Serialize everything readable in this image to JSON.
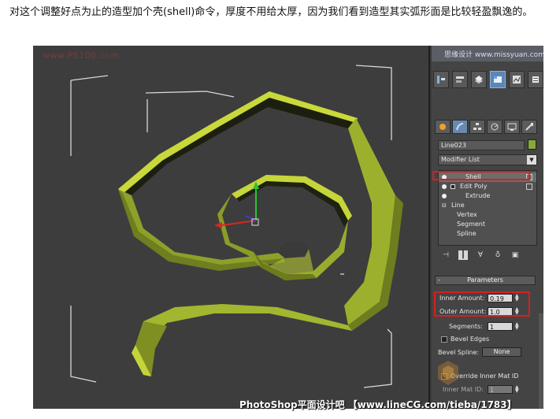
{
  "article": {
    "intro": "对这个调整好点为止的造型加个壳(shell)命令，厚度不用给太厚，因为我们看到造型其实弧形面是比较轻盈飘逸的。"
  },
  "viewport": {
    "top_watermark": "www.PS100.com",
    "bottom_watermark": "PhotoShop平面设计吧 【www.lineCG.com/tieba/1783】",
    "object_color": "#9fb32c",
    "grid_color": "#d8d8d8"
  },
  "panel": {
    "strip_text": "思缘设计 www.missyuan.com",
    "toolbar_icons": [
      "align-icon",
      "tools-icon",
      "layers-icon",
      "modify-icon",
      "render-icon",
      "pin-icon"
    ],
    "tabs": [
      "create-icon",
      "modify-icon",
      "hierarchy-icon",
      "motion-icon",
      "display-icon",
      "utilities-icon"
    ],
    "object_name": "Line023",
    "object_color": "#87a93a",
    "modifier_list_label": "Modifier List",
    "stack": [
      {
        "label": "Shell",
        "selected": true
      },
      {
        "label": "Edit Poly",
        "selected": false
      },
      {
        "label": "Extrude",
        "selected": false
      },
      {
        "label": "Line",
        "selected": false
      },
      {
        "label": "Vertex",
        "selected": false
      },
      {
        "label": "Segment",
        "selected": false
      },
      {
        "label": "Spline",
        "selected": false
      }
    ],
    "parameters_title": "Parameters",
    "inner_amount_label": "Inner Amount:",
    "inner_amount_value": "0.19",
    "outer_amount_label": "Outer Amount:",
    "outer_amount_value": "1.0",
    "segments_label": "Segments:",
    "segments_value": "1",
    "bevel_edges_label": "Bevel Edges",
    "bevel_spline_label": "Bevel Spline:",
    "bevel_spline_value": "None",
    "override_inner_label": "Override Inner Mat ID",
    "inner_mat_id_label": "Inner Mat ID:",
    "inner_mat_id_value": "1"
  },
  "colors": {
    "highlight": "#d71f1f",
    "accent": "#5b86b5"
  }
}
